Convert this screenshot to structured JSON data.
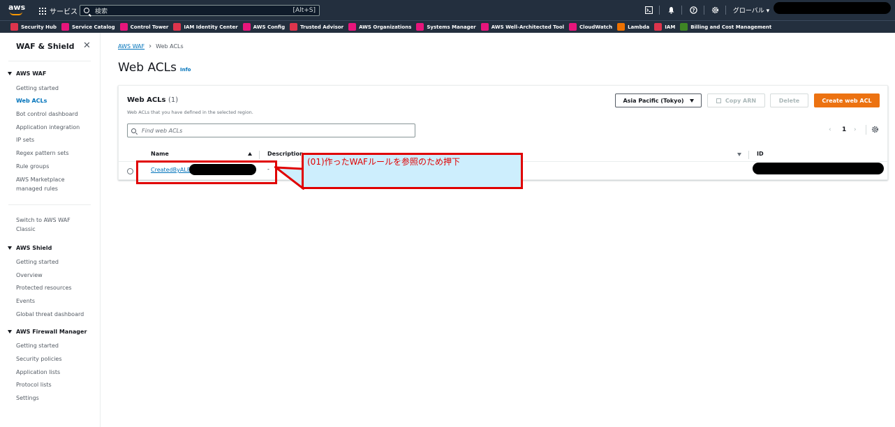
{
  "topbar": {
    "logo": "aws",
    "services_label": "サービス",
    "search_placeholder": "検索",
    "search_shortcut": "[Alt+S]",
    "region_menu": "グローバル ▾",
    "icons": [
      "cloudshell-icon",
      "bell-icon",
      "help-icon",
      "gear-icon"
    ]
  },
  "favorites": [
    {
      "label": "Security Hub",
      "color": "#dd344c"
    },
    {
      "label": "Service Catalog",
      "color": "#e7157b"
    },
    {
      "label": "Control Tower",
      "color": "#e7157b"
    },
    {
      "label": "IAM Identity Center",
      "color": "#dd344c"
    },
    {
      "label": "AWS Config",
      "color": "#e7157b"
    },
    {
      "label": "Trusted Advisor",
      "color": "#dd344c"
    },
    {
      "label": "AWS Organizations",
      "color": "#e7157b"
    },
    {
      "label": "Systems Manager",
      "color": "#e7157b"
    },
    {
      "label": "AWS Well-Architected Tool",
      "color": "#e7157b"
    },
    {
      "label": "CloudWatch",
      "color": "#e7157b"
    },
    {
      "label": "Lambda",
      "color": "#ed7100"
    },
    {
      "label": "IAM",
      "color": "#dd344c"
    },
    {
      "label": "Billing and Cost Management",
      "color": "#3f8624"
    }
  ],
  "sidebar": {
    "title": "WAF & Shield",
    "sections": [
      {
        "label": "AWS WAF"
      },
      {
        "label": "AWS Shield"
      },
      {
        "label": "AWS Firewall Manager"
      }
    ],
    "waf_items": [
      {
        "label": "Getting started"
      },
      {
        "label": "Web ACLs"
      },
      {
        "label": "Bot control dashboard"
      },
      {
        "label": "Application integration"
      },
      {
        "label": "IP sets"
      },
      {
        "label": "Regex pattern sets"
      },
      {
        "label": "Rule groups"
      },
      {
        "label": "AWS Marketplace managed rules"
      }
    ],
    "switch_label": "Switch to AWS WAF Classic",
    "shield_items": [
      {
        "label": "Getting started"
      },
      {
        "label": "Overview"
      },
      {
        "label": "Protected resources"
      },
      {
        "label": "Events"
      },
      {
        "label": "Global threat dashboard"
      }
    ],
    "fm_items": [
      {
        "label": "Getting started"
      },
      {
        "label": "Security policies"
      },
      {
        "label": "Application lists"
      },
      {
        "label": "Protocol lists"
      },
      {
        "label": "Settings"
      }
    ]
  },
  "breadcrumb": {
    "parent": "AWS WAF",
    "current": "Web ACLs"
  },
  "page": {
    "title": "Web ACLs",
    "info": "Info"
  },
  "panel": {
    "title": "Web ACLs",
    "count": "(1)",
    "description": "Web ACLs that you have defined in the selected region.",
    "region": "Asia Pacific (Tokyo)",
    "copy_arn": "Copy ARN",
    "delete": "Delete",
    "create": "Create web ACL",
    "filter_placeholder": "Find web ACLs",
    "page_number": "1",
    "columns": [
      "Name",
      "Description",
      "ID"
    ],
    "rows": [
      {
        "name": "CreatedByALB",
        "description": "-"
      }
    ]
  },
  "annotation": {
    "text": "(01)作ったWAFルールを参照のため押下"
  }
}
